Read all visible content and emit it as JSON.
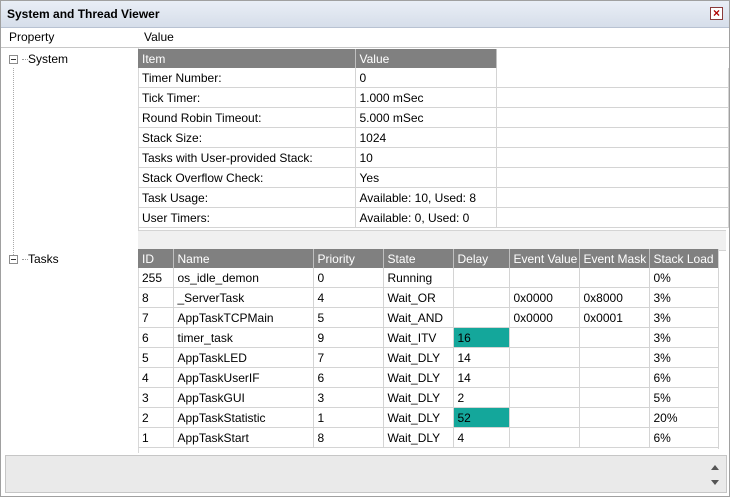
{
  "window": {
    "title": "System and Thread Viewer",
    "close_label": "×"
  },
  "columns": {
    "property": "Property",
    "value": "Value"
  },
  "tree": {
    "system_label": "System",
    "tasks_label": "Tasks"
  },
  "system": {
    "headers": [
      "Item",
      "Value"
    ],
    "rows": [
      [
        "Timer Number:",
        "0"
      ],
      [
        "Tick Timer:",
        "1.000 mSec"
      ],
      [
        "Round Robin Timeout:",
        "5.000 mSec"
      ],
      [
        "Stack Size:",
        "1024"
      ],
      [
        "Tasks with User-provided Stack:",
        "10"
      ],
      [
        "Stack Overflow Check:",
        "Yes"
      ],
      [
        "Task Usage:",
        "Available: 10, Used: 8"
      ],
      [
        "User Timers:",
        "Available: 0, Used: 0"
      ]
    ]
  },
  "tasks": {
    "headers": [
      "ID",
      "Name",
      "Priority",
      "State",
      "Delay",
      "Event Value",
      "Event Mask",
      "Stack Load"
    ],
    "highlight_color": "#14a79b",
    "rows": [
      [
        "255",
        "os_idle_demon",
        "0",
        "Running",
        "",
        "",
        "",
        "0%"
      ],
      [
        "8",
        "_ServerTask",
        "4",
        "Wait_OR",
        "",
        "0x0000",
        "0x8000",
        "3%"
      ],
      [
        "7",
        "AppTaskTCPMain",
        "5",
        "Wait_AND",
        "",
        "0x0000",
        "0x0001",
        "3%"
      ],
      [
        "6",
        "timer_task",
        "9",
        "Wait_ITV",
        "16",
        "",
        "",
        "3%"
      ],
      [
        "5",
        "AppTaskLED",
        "7",
        "Wait_DLY",
        "14",
        "",
        "",
        "3%"
      ],
      [
        "4",
        "AppTaskUserIF",
        "6",
        "Wait_DLY",
        "14",
        "",
        "",
        "6%"
      ],
      [
        "3",
        "AppTaskGUI",
        "3",
        "Wait_DLY",
        "2",
        "",
        "",
        "5%"
      ],
      [
        "2",
        "AppTaskStatistic",
        "1",
        "Wait_DLY",
        "52",
        "",
        "",
        "20%"
      ],
      [
        "1",
        "AppTaskStart",
        "8",
        "Wait_DLY",
        "4",
        "",
        "",
        "6%"
      ]
    ],
    "highlighted_delay_rows": [
      3,
      7
    ]
  }
}
